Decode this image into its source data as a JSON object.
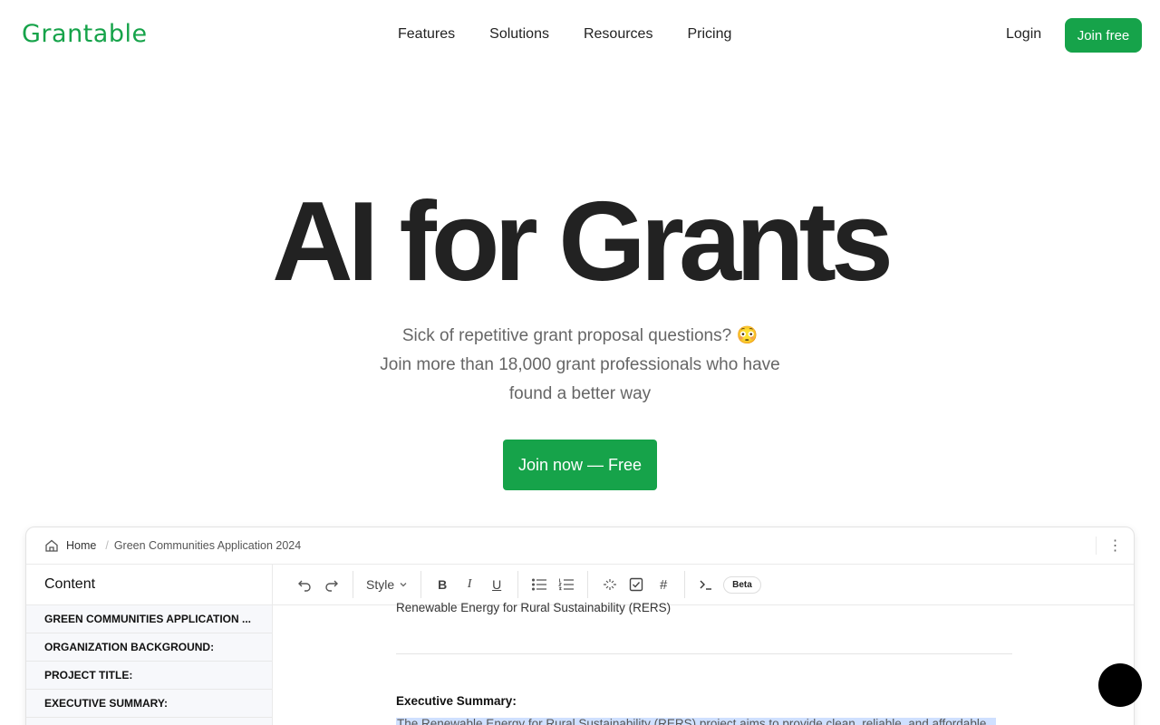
{
  "nav": {
    "logo": "Grantable",
    "links": [
      "Features",
      "Solutions",
      "Resources",
      "Pricing"
    ],
    "login": "Login",
    "join_free": "Join free"
  },
  "hero": {
    "title": "AI for Grants",
    "subtitle_line1": "Sick of repetitive grant proposal questions? 😳",
    "subtitle_line2": "Join more than 18,000 grant professionals who have",
    "subtitle_line3": "found a better way",
    "cta": "Join now — Free"
  },
  "app": {
    "breadcrumb": {
      "home": "Home",
      "current": "Green Communities Application 2024"
    },
    "sidebar": {
      "heading": "Content",
      "items": [
        "GREEN COMMUNITIES APPLICATION ...",
        "ORGANIZATION BACKGROUND:",
        "PROJECT TITLE:",
        "EXECUTIVE SUMMARY:",
        ""
      ]
    },
    "toolbar": {
      "style_label": "Style",
      "bold": "B",
      "italic": "I",
      "underline": "U",
      "hash": "#",
      "beta": "Beta"
    },
    "editor": {
      "line1": "Renewable Energy for Rural Sustainability (RERS)",
      "heading": "Executive Summary:",
      "highlight": "The Renewable Energy for Rural Sustainability (RERS) project aims to provide clean, reliable, and affordable"
    }
  },
  "colors": {
    "brand": "#16a34a",
    "highlight": "#cfe0ff"
  }
}
